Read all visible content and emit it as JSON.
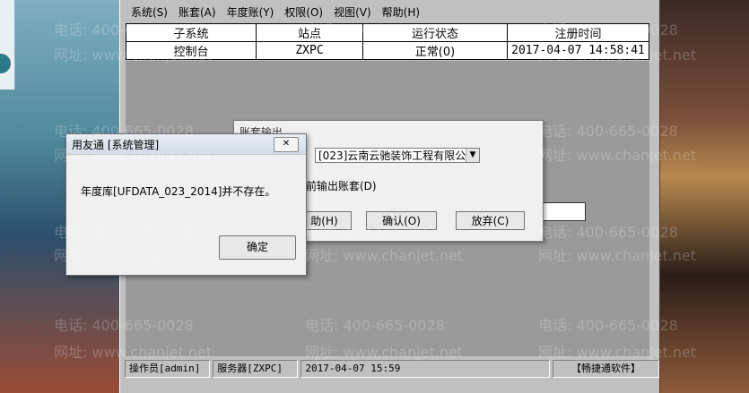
{
  "menu": [
    "系统(S)",
    "账套(A)",
    "年度账(Y)",
    "权限(O)",
    "视图(V)",
    "帮助(H)"
  ],
  "grid": {
    "headers": [
      "子系统",
      "站点",
      "运行状态",
      "注册时间"
    ],
    "rows": [
      [
        "控制台",
        "ZXPC",
        "正常(0)",
        "2017-04-07 14:58:41"
      ]
    ]
  },
  "status": {
    "operator": "操作员[admin]",
    "server": "服务器[ZXPC]",
    "datetime": "2017-04-07 15:59",
    "brand": "【畅捷通软件】"
  },
  "account_dialog": {
    "title": "账套输出",
    "account_select": "[023]云南云驰装饰工程有限公",
    "option_label": "前输出账套(D)",
    "buttons": {
      "help": "助(H)",
      "confirm": "确认(O)",
      "abandon": "放弃(C)"
    }
  },
  "message_box": {
    "title": "用友通 [系统管理]",
    "message": "年度库[UFDATA_023_2014]并不存在。",
    "ok": "确定"
  },
  "watermark": {
    "phone": "电话: 400-665-0028",
    "site": "网址: www.chanjet.net"
  }
}
